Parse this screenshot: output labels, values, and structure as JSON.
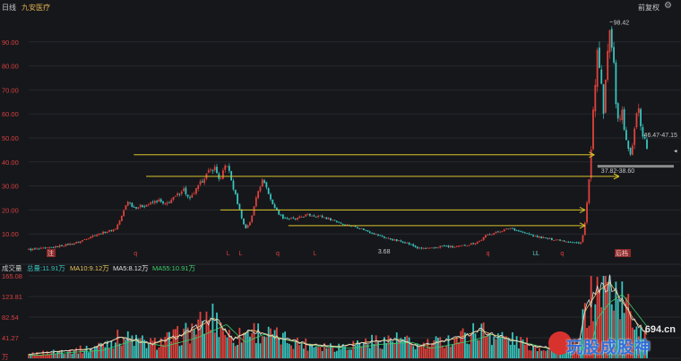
{
  "header": {
    "period": "日线",
    "stock_name": "九安医疗",
    "adjust": "前复权"
  },
  "volume_bar": {
    "title": "成交量",
    "total": "总量:11.91万",
    "ma10": "MA10:9.12万",
    "ma5": "MA5:8.12万",
    "ma55": "MA55:10.91万"
  },
  "colors": {
    "up": "#e0423c",
    "down": "#37c5bd",
    "axis_label": "#d64040",
    "ma10": "#e8c35a",
    "ma5": "#e0e0e0",
    "ma55": "#3dcf6a",
    "trendline": "#d8c22a"
  },
  "markers": {
    "q": "q",
    "L": "L",
    "letters": "LL",
    "badge1": "注",
    "badge2": "后档"
  },
  "chart_data": [
    {
      "type": "candlestick",
      "title": "",
      "y_ticks": [
        "90.00",
        "80.00",
        "70.00",
        "60.00",
        "50.00",
        "40.00",
        "30.00",
        "20.00",
        "10.00"
      ],
      "y_tick_values": [
        90,
        80,
        70,
        60,
        50,
        40,
        30,
        20,
        10
      ],
      "ylim": [
        0,
        100
      ],
      "annotations": {
        "high": "98.42",
        "low": "3.68",
        "range_a": "46.47-47.15",
        "range_b": "37.82-38.60"
      },
      "price_path": [
        [
          0.0,
          3.5
        ],
        [
          0.03,
          4.0
        ],
        [
          0.05,
          5.0
        ],
        [
          0.08,
          6.5
        ],
        [
          0.1,
          9.0
        ],
        [
          0.12,
          10.5
        ],
        [
          0.14,
          12.0
        ],
        [
          0.15,
          17.0
        ],
        [
          0.16,
          24.0
        ],
        [
          0.17,
          21.0
        ],
        [
          0.19,
          22.0
        ],
        [
          0.21,
          24.0
        ],
        [
          0.22,
          22.0
        ],
        [
          0.24,
          26.0
        ],
        [
          0.25,
          29.0
        ],
        [
          0.26,
          24.0
        ],
        [
          0.27,
          28.0
        ],
        [
          0.285,
          34.0
        ],
        [
          0.3,
          38.0
        ],
        [
          0.31,
          32.0
        ],
        [
          0.32,
          40.0
        ],
        [
          0.33,
          30.0
        ],
        [
          0.34,
          21.0
        ],
        [
          0.35,
          12.0
        ],
        [
          0.36,
          16.0
        ],
        [
          0.37,
          28.0
        ],
        [
          0.38,
          33.0
        ],
        [
          0.39,
          25.0
        ],
        [
          0.4,
          20.0
        ],
        [
          0.41,
          17.0
        ],
        [
          0.43,
          16.0
        ],
        [
          0.45,
          18.0
        ],
        [
          0.47,
          17.5
        ],
        [
          0.49,
          16.0
        ],
        [
          0.51,
          14.0
        ],
        [
          0.53,
          13.0
        ],
        [
          0.55,
          11.0
        ],
        [
          0.57,
          9.0
        ],
        [
          0.59,
          7.5
        ],
        [
          0.61,
          6.5
        ],
        [
          0.63,
          4.0
        ],
        [
          0.65,
          3.9
        ],
        [
          0.67,
          5.0
        ],
        [
          0.69,
          4.5
        ],
        [
          0.71,
          5.5
        ],
        [
          0.73,
          7.0
        ],
        [
          0.74,
          9.5
        ],
        [
          0.76,
          11.0
        ],
        [
          0.78,
          12.5
        ],
        [
          0.8,
          10.5
        ],
        [
          0.82,
          9.0
        ],
        [
          0.84,
          8.0
        ],
        [
          0.86,
          7.5
        ],
        [
          0.88,
          6.5
        ],
        [
          0.89,
          6.0
        ],
        [
          0.895,
          7.5
        ],
        [
          0.9,
          15.0
        ],
        [
          0.905,
          28.0
        ],
        [
          0.91,
          45.0
        ],
        [
          0.915,
          70.0
        ],
        [
          0.92,
          85.0
        ],
        [
          0.925,
          75.0
        ],
        [
          0.93,
          60.0
        ],
        [
          0.935,
          80.0
        ],
        [
          0.94,
          98.0
        ],
        [
          0.945,
          85.0
        ],
        [
          0.95,
          65.0
        ],
        [
          0.955,
          55.0
        ],
        [
          0.96,
          62.0
        ],
        [
          0.965,
          50.0
        ],
        [
          0.97,
          45.0
        ],
        [
          0.975,
          42.0
        ],
        [
          0.98,
          55.0
        ],
        [
          0.985,
          65.0
        ],
        [
          0.99,
          55.0
        ],
        [
          0.995,
          50.0
        ],
        [
          1.0,
          46.0
        ]
      ],
      "trendlines_y": [
        43.0,
        34.0,
        20.0,
        13.5,
        38.2
      ],
      "marker_x": {
        "q": [
          0.17,
          0.4,
          0.74,
          0.86
        ],
        "L": [
          0.32,
          0.34,
          0.46,
          0.82
        ],
        "letters": [
          0.815
        ]
      }
    },
    {
      "type": "bar",
      "title": "成交量",
      "y_ticks": [
        "165.08",
        "123.81",
        "82.54",
        "41.27",
        "万"
      ],
      "y_tick_values": [
        165.08,
        123.81,
        82.54,
        41.27,
        0
      ],
      "ylim": [
        0,
        165.08
      ],
      "volume_profile": [
        [
          0.0,
          8
        ],
        [
          0.05,
          15
        ],
        [
          0.1,
          20
        ],
        [
          0.15,
          45
        ],
        [
          0.2,
          30
        ],
        [
          0.25,
          50
        ],
        [
          0.28,
          70
        ],
        [
          0.3,
          85
        ],
        [
          0.33,
          40
        ],
        [
          0.36,
          60
        ],
        [
          0.4,
          45
        ],
        [
          0.45,
          30
        ],
        [
          0.5,
          25
        ],
        [
          0.55,
          35
        ],
        [
          0.6,
          40
        ],
        [
          0.63,
          25
        ],
        [
          0.65,
          30
        ],
        [
          0.7,
          45
        ],
        [
          0.73,
          60
        ],
        [
          0.75,
          50
        ],
        [
          0.78,
          40
        ],
        [
          0.82,
          25
        ],
        [
          0.86,
          20
        ],
        [
          0.89,
          30
        ],
        [
          0.9,
          100
        ],
        [
          0.92,
          140
        ],
        [
          0.94,
          160
        ],
        [
          0.96,
          120
        ],
        [
          0.98,
          80
        ],
        [
          1.0,
          50
        ]
      ]
    }
  ]
}
